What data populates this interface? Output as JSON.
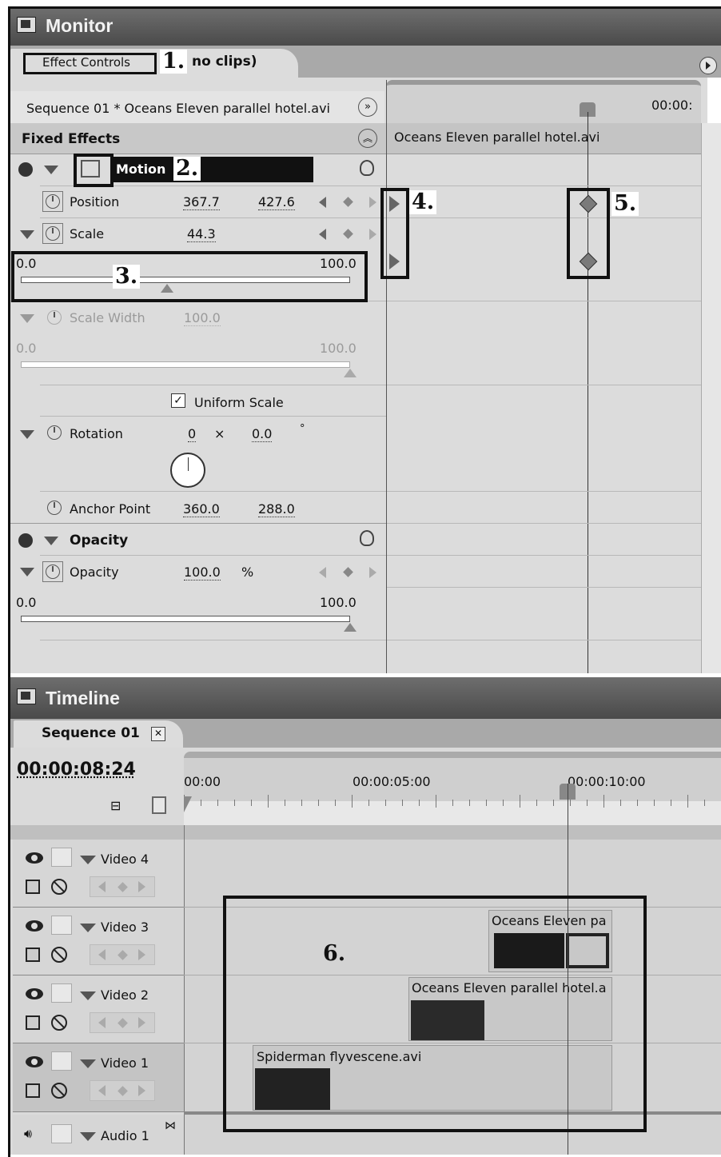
{
  "monitor": {
    "title": "Monitor",
    "tab_label": "Effect Controls",
    "tab_suffix": "no clips)",
    "sequence_label": "Sequence 01 * Oceans Eleven parallel hotel.avi",
    "timecode_partial": "00:00:",
    "clip_name": "Oceans Eleven parallel hotel.avi",
    "fixed_effects_label": "Fixed Effects",
    "motion": {
      "label": "Motion",
      "position": {
        "label": "Position",
        "x": "367.7",
        "y": "427.6"
      },
      "scale": {
        "label": "Scale",
        "value": "44.3",
        "min": "0.0",
        "max": "100.0",
        "level_fraction": 0.443
      },
      "scale_width": {
        "label": "Scale Width",
        "value": "100.0",
        "min": "0.0",
        "max": "100.0",
        "level_fraction": 1.0
      },
      "uniform_scale": {
        "label": "Uniform Scale",
        "checked": true
      },
      "rotation": {
        "label": "Rotation",
        "turns": "0",
        "x": "×",
        "degrees": "0.0",
        "deg_symbol": "°"
      },
      "anchor_point": {
        "label": "Anchor Point",
        "x": "360.0",
        "y": "288.0"
      }
    },
    "opacity": {
      "section_label": "Opacity",
      "label": "Opacity",
      "value": "100.0",
      "unit": "%",
      "min": "0.0",
      "max": "100.0",
      "level_fraction": 1.0
    }
  },
  "timeline": {
    "title": "Timeline",
    "tab_label": "Sequence 01",
    "timecode": "00:00:08:24",
    "ruler": [
      "00:00",
      "00:00:05:00",
      "00:00:10:00"
    ],
    "tracks": [
      {
        "label": "Video 4"
      },
      {
        "label": "Video 3"
      },
      {
        "label": "Video 2"
      },
      {
        "label": "Video 1"
      },
      {
        "label": "Audio 1"
      }
    ],
    "clips": {
      "video3": "Oceans Eleven pa",
      "video2": "Oceans Eleven parallel hotel.a",
      "video1": "Spiderman flyvescene.avi"
    }
  },
  "callouts": [
    "1.",
    "2.",
    "3.",
    "4.",
    "5.",
    "6."
  ]
}
